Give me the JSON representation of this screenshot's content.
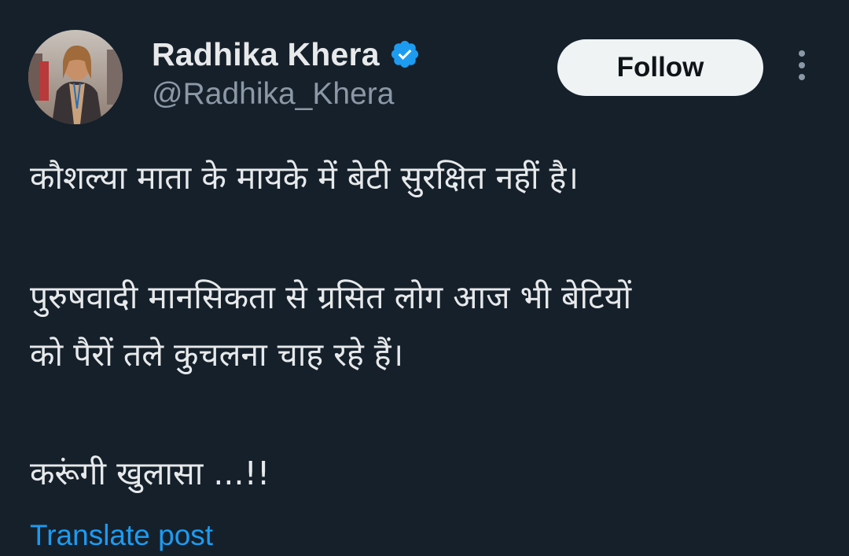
{
  "author": {
    "display_name": "Radhika Khera",
    "handle": "@Radhika_Khera",
    "verified": true,
    "verified_color": "#1d9bf0"
  },
  "actions": {
    "follow_label": "Follow",
    "more_icon": "more-vertical-icon"
  },
  "post": {
    "paragraphs": [
      "कौशल्या माता के मायके में बेटी सुरक्षित नहीं है।",
      "पुरुषवादी मानसिकता से ग्रसित लोग आज भी बेटियों\nको पैरों तले कुचलना चाह रहे हैं।",
      "करूंगी खुलासा ...!!"
    ],
    "translate_label": "Translate post"
  },
  "colors": {
    "background": "#15202b",
    "text": "#e7e9ea",
    "secondary_text": "#8b98a5",
    "accent": "#1d9bf0",
    "button_bg": "#eff3f4"
  }
}
